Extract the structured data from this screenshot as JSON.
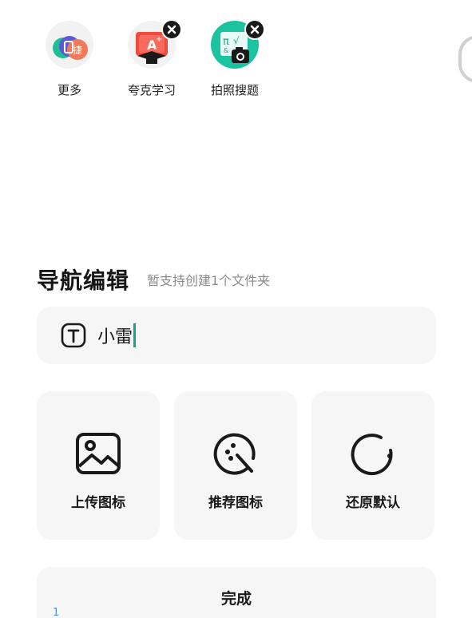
{
  "shortcuts": [
    {
      "label": "更多",
      "icon": "more-apps-icon",
      "badge": "捷",
      "removable": false
    },
    {
      "label": "夸克学习",
      "icon": "quark-learning-icon",
      "removable": true
    },
    {
      "label": "拍照搜题",
      "icon": "photo-search-icon",
      "removable": true
    }
  ],
  "section": {
    "title": "导航编辑",
    "hint": "暂支持创建1个文件夹"
  },
  "name_field": {
    "icon": "text-t-icon",
    "value": "小雷"
  },
  "actions": [
    {
      "label": "上传图标",
      "icon": "image-upload-icon"
    },
    {
      "label": "推荐图标",
      "icon": "recommend-palette-icon"
    },
    {
      "label": "还原默认",
      "icon": "restore-default-icon"
    }
  ],
  "done_label": "完成",
  "page_number": "1",
  "colors": {
    "accent": "#11a58a",
    "card": "#f6f6f6"
  }
}
